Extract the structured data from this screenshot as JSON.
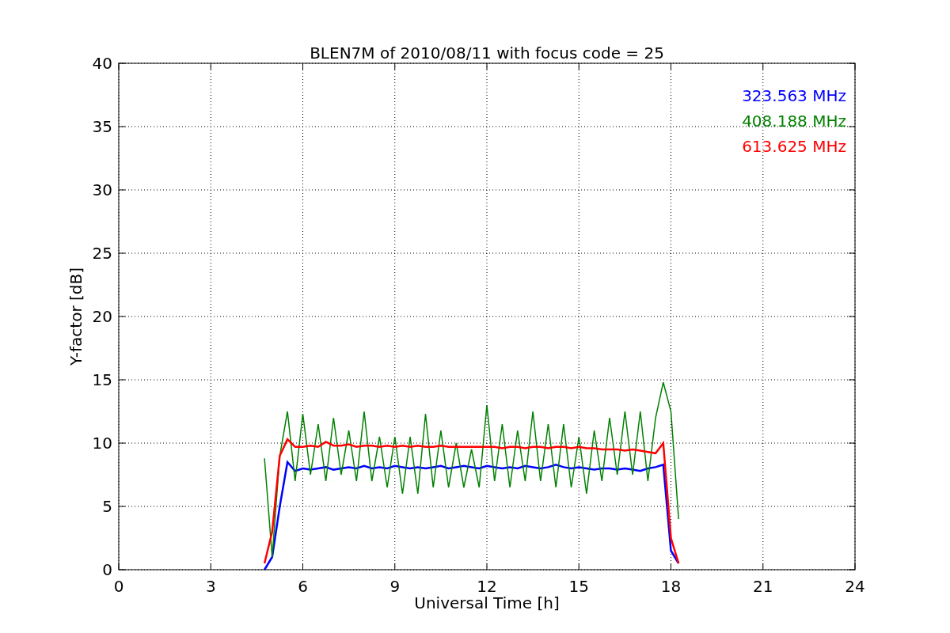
{
  "chart_data": {
    "type": "line",
    "title": "BLEN7M of 2010/08/11 with focus code = 25",
    "xlabel": "Universal Time [h]",
    "ylabel": "Y-factor [dB]",
    "x": [
      4.75,
      5,
      5.25,
      5.5,
      5.75,
      6,
      6.25,
      6.5,
      6.75,
      7,
      7.25,
      7.5,
      7.75,
      8,
      8.25,
      8.5,
      8.75,
      9,
      9.25,
      9.5,
      9.75,
      10,
      10.25,
      10.5,
      10.75,
      11,
      11.25,
      11.5,
      11.75,
      12,
      12.25,
      12.5,
      12.75,
      13,
      13.25,
      13.5,
      13.75,
      14,
      14.25,
      14.5,
      14.75,
      15,
      15.25,
      15.5,
      15.75,
      16,
      16.25,
      16.5,
      16.75,
      17,
      17.25,
      17.5,
      17.75,
      18,
      18.25
    ],
    "series": [
      {
        "name": "323.563 MHz",
        "color": "#0000ff",
        "values": [
          0,
          1,
          5,
          8.5,
          7.8,
          8,
          7.9,
          8,
          8.1,
          7.9,
          8,
          8.1,
          8,
          8.2,
          8,
          8.1,
          8,
          8.2,
          8.1,
          8,
          8.1,
          8,
          8.1,
          8.2,
          8,
          8.1,
          8.2,
          8.1,
          8,
          8.2,
          8.1,
          8,
          8.1,
          8,
          8.2,
          8.1,
          8,
          8.1,
          8.3,
          8.1,
          8,
          8.1,
          8,
          7.9,
          8,
          8,
          7.9,
          8,
          7.9,
          7.8,
          8,
          8.1,
          8.3,
          1.5,
          0.5
        ]
      },
      {
        "name": "408.188 MHz",
        "color": "#008000",
        "values": [
          8.8,
          1,
          9,
          12.5,
          7,
          12.3,
          7.5,
          11.5,
          7,
          12,
          7.5,
          11,
          7,
          12.5,
          7,
          10.5,
          6.5,
          10.5,
          6,
          10.5,
          6,
          12.3,
          6.5,
          11,
          6.5,
          10,
          6.5,
          9.5,
          6.5,
          13,
          7,
          11.5,
          6.5,
          11,
          7,
          12.5,
          7,
          11.5,
          6.5,
          11.5,
          6.5,
          10.5,
          6,
          11,
          7,
          12,
          7.5,
          12.5,
          7.5,
          12.5,
          7,
          12,
          14.8,
          12.5,
          4
        ]
      },
      {
        "name": "613.625 MHz",
        "color": "#ff0000",
        "values": [
          0.5,
          3,
          9,
          10.3,
          9.7,
          9.7,
          9.8,
          9.7,
          10.1,
          9.8,
          9.8,
          9.9,
          9.7,
          9.8,
          9.8,
          9.7,
          9.8,
          9.7,
          9.8,
          9.7,
          9.8,
          9.7,
          9.7,
          9.8,
          9.7,
          9.7,
          9.7,
          9.7,
          9.7,
          9.7,
          9.7,
          9.6,
          9.7,
          9.7,
          9.6,
          9.7,
          9.7,
          9.6,
          9.7,
          9.7,
          9.6,
          9.7,
          9.6,
          9.6,
          9.5,
          9.5,
          9.5,
          9.4,
          9.5,
          9.4,
          9.3,
          9.2,
          10,
          2.5,
          0.5
        ]
      }
    ],
    "xlim": [
      0,
      24
    ],
    "ylim": [
      0,
      40
    ],
    "xticks": [
      0,
      3,
      6,
      9,
      12,
      15,
      18,
      21,
      24
    ],
    "yticks": [
      0,
      5,
      10,
      15,
      20,
      25,
      30,
      35,
      40
    ],
    "grid": true
  }
}
